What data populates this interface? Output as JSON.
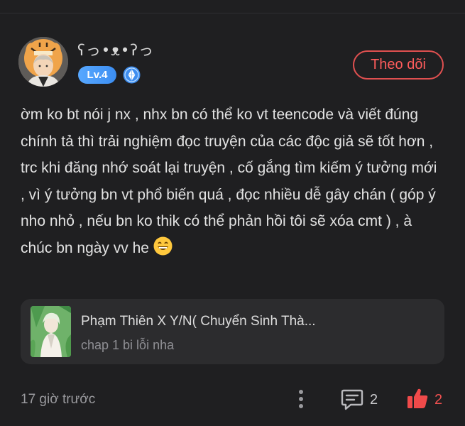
{
  "comment": {
    "user": {
      "name": "ʕっ•ᴥ•ʔっ",
      "level": "Lv.4",
      "diamond_icon": "diamond-badge-icon",
      "avatar_icon": "tiger-hood-avatar"
    },
    "follow_label": "Theo dõi",
    "text": "ờm ko bt nói j nx , nhx bn có thể ko vt teencode và viết đúng chính tả thì trải nghiệm đọc truyện của các độc giả sẽ tốt hơn , trc khi đăng nhớ soát lại truyện , cố gắng tìm kiếm ý tưởng mới , vì ý tưởng bn vt phổ biến quá , đọc nhiều dễ gây chán ( góp ý nho nhỏ , nếu bn ko thik có thể phản hồi tôi sẽ xóa cmt ) , à chúc bn ngày vv he",
    "story": {
      "title": "Phạm Thiên X Y/N( Chuyển Sinh Thà...",
      "chapter": "chap 1 bi lỗi nha"
    },
    "footer": {
      "time": "17 giờ trước",
      "reply_count": "2",
      "like_count": "2"
    }
  },
  "colors": {
    "background": "#1f1f21",
    "accent": "#f05050",
    "level_badge": "#4a9bf8",
    "card": "#2c2c2e"
  }
}
